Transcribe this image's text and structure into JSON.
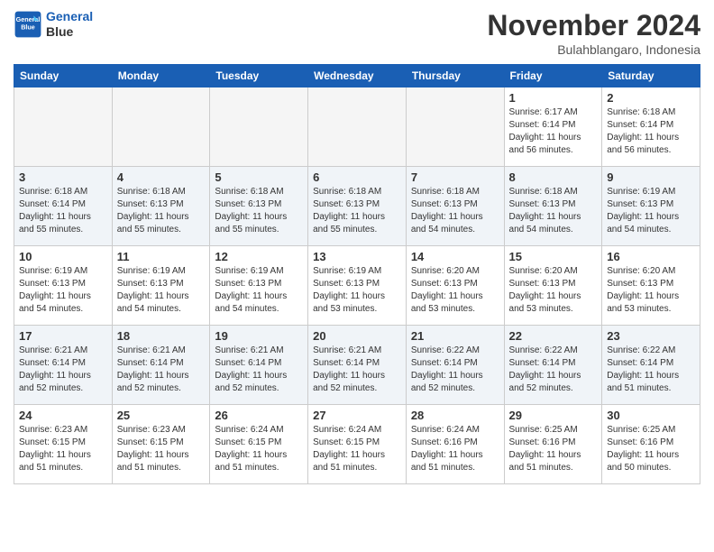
{
  "header": {
    "logo_line1": "General",
    "logo_line2": "Blue",
    "month": "November 2024",
    "location": "Bulahblangaro, Indonesia"
  },
  "weekdays": [
    "Sunday",
    "Monday",
    "Tuesday",
    "Wednesday",
    "Thursday",
    "Friday",
    "Saturday"
  ],
  "weeks": [
    [
      {
        "day": "",
        "info": ""
      },
      {
        "day": "",
        "info": ""
      },
      {
        "day": "",
        "info": ""
      },
      {
        "day": "",
        "info": ""
      },
      {
        "day": "",
        "info": ""
      },
      {
        "day": "1",
        "info": "Sunrise: 6:17 AM\nSunset: 6:14 PM\nDaylight: 11 hours\nand 56 minutes."
      },
      {
        "day": "2",
        "info": "Sunrise: 6:18 AM\nSunset: 6:14 PM\nDaylight: 11 hours\nand 56 minutes."
      }
    ],
    [
      {
        "day": "3",
        "info": "Sunrise: 6:18 AM\nSunset: 6:14 PM\nDaylight: 11 hours\nand 55 minutes."
      },
      {
        "day": "4",
        "info": "Sunrise: 6:18 AM\nSunset: 6:13 PM\nDaylight: 11 hours\nand 55 minutes."
      },
      {
        "day": "5",
        "info": "Sunrise: 6:18 AM\nSunset: 6:13 PM\nDaylight: 11 hours\nand 55 minutes."
      },
      {
        "day": "6",
        "info": "Sunrise: 6:18 AM\nSunset: 6:13 PM\nDaylight: 11 hours\nand 55 minutes."
      },
      {
        "day": "7",
        "info": "Sunrise: 6:18 AM\nSunset: 6:13 PM\nDaylight: 11 hours\nand 54 minutes."
      },
      {
        "day": "8",
        "info": "Sunrise: 6:18 AM\nSunset: 6:13 PM\nDaylight: 11 hours\nand 54 minutes."
      },
      {
        "day": "9",
        "info": "Sunrise: 6:19 AM\nSunset: 6:13 PM\nDaylight: 11 hours\nand 54 minutes."
      }
    ],
    [
      {
        "day": "10",
        "info": "Sunrise: 6:19 AM\nSunset: 6:13 PM\nDaylight: 11 hours\nand 54 minutes."
      },
      {
        "day": "11",
        "info": "Sunrise: 6:19 AM\nSunset: 6:13 PM\nDaylight: 11 hours\nand 54 minutes."
      },
      {
        "day": "12",
        "info": "Sunrise: 6:19 AM\nSunset: 6:13 PM\nDaylight: 11 hours\nand 54 minutes."
      },
      {
        "day": "13",
        "info": "Sunrise: 6:19 AM\nSunset: 6:13 PM\nDaylight: 11 hours\nand 53 minutes."
      },
      {
        "day": "14",
        "info": "Sunrise: 6:20 AM\nSunset: 6:13 PM\nDaylight: 11 hours\nand 53 minutes."
      },
      {
        "day": "15",
        "info": "Sunrise: 6:20 AM\nSunset: 6:13 PM\nDaylight: 11 hours\nand 53 minutes."
      },
      {
        "day": "16",
        "info": "Sunrise: 6:20 AM\nSunset: 6:13 PM\nDaylight: 11 hours\nand 53 minutes."
      }
    ],
    [
      {
        "day": "17",
        "info": "Sunrise: 6:21 AM\nSunset: 6:14 PM\nDaylight: 11 hours\nand 52 minutes."
      },
      {
        "day": "18",
        "info": "Sunrise: 6:21 AM\nSunset: 6:14 PM\nDaylight: 11 hours\nand 52 minutes."
      },
      {
        "day": "19",
        "info": "Sunrise: 6:21 AM\nSunset: 6:14 PM\nDaylight: 11 hours\nand 52 minutes."
      },
      {
        "day": "20",
        "info": "Sunrise: 6:21 AM\nSunset: 6:14 PM\nDaylight: 11 hours\nand 52 minutes."
      },
      {
        "day": "21",
        "info": "Sunrise: 6:22 AM\nSunset: 6:14 PM\nDaylight: 11 hours\nand 52 minutes."
      },
      {
        "day": "22",
        "info": "Sunrise: 6:22 AM\nSunset: 6:14 PM\nDaylight: 11 hours\nand 52 minutes."
      },
      {
        "day": "23",
        "info": "Sunrise: 6:22 AM\nSunset: 6:14 PM\nDaylight: 11 hours\nand 51 minutes."
      }
    ],
    [
      {
        "day": "24",
        "info": "Sunrise: 6:23 AM\nSunset: 6:15 PM\nDaylight: 11 hours\nand 51 minutes."
      },
      {
        "day": "25",
        "info": "Sunrise: 6:23 AM\nSunset: 6:15 PM\nDaylight: 11 hours\nand 51 minutes."
      },
      {
        "day": "26",
        "info": "Sunrise: 6:24 AM\nSunset: 6:15 PM\nDaylight: 11 hours\nand 51 minutes."
      },
      {
        "day": "27",
        "info": "Sunrise: 6:24 AM\nSunset: 6:15 PM\nDaylight: 11 hours\nand 51 minutes."
      },
      {
        "day": "28",
        "info": "Sunrise: 6:24 AM\nSunset: 6:16 PM\nDaylight: 11 hours\nand 51 minutes."
      },
      {
        "day": "29",
        "info": "Sunrise: 6:25 AM\nSunset: 6:16 PM\nDaylight: 11 hours\nand 51 minutes."
      },
      {
        "day": "30",
        "info": "Sunrise: 6:25 AM\nSunset: 6:16 PM\nDaylight: 11 hours\nand 50 minutes."
      }
    ]
  ]
}
